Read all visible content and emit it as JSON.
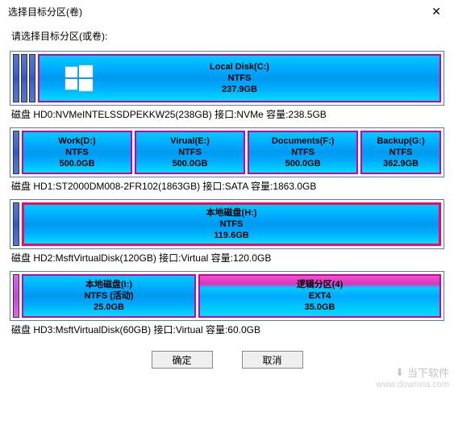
{
  "window": {
    "title": "选择目标分区(卷)"
  },
  "instruction": "请选择目标分区(或卷):",
  "disks": [
    {
      "label": "磁盘 HD0:NVMeINTELSSDPEKKW25(238GB) 接口:NVMe 容量:238.5GB",
      "partitions": [
        {
          "name": "Local Disk(C:)",
          "fs": "NTFS",
          "size": "237.9GB"
        }
      ]
    },
    {
      "label": "磁盘 HD1:ST2000DM008-2FR102(1863GB) 接口:SATA 容量:1863.0GB",
      "partitions": [
        {
          "name": "Work(D:)",
          "fs": "NTFS",
          "size": "500.0GB"
        },
        {
          "name": "Virual(E:)",
          "fs": "NTFS",
          "size": "500.0GB"
        },
        {
          "name": "Documents(F:)",
          "fs": "NTFS",
          "size": "500.0GB"
        },
        {
          "name": "Backup(G:)",
          "fs": "NTFS",
          "size": "362.9GB"
        }
      ]
    },
    {
      "label": "磁盘 HD2:MsftVirtualDisk(120GB) 接口:Virtual 容量:120.0GB",
      "partitions": [
        {
          "name": "本地磁盘(H:)",
          "fs": "NTFS",
          "size": "119.6GB"
        }
      ]
    },
    {
      "label": "磁盘 HD3:MsftVirtualDisk(60GB) 接口:Virtual 容量:60.0GB",
      "partitions": [
        {
          "name": "本地磁盘(I:)",
          "fs": "NTFS (活动)",
          "size": "25.0GB"
        },
        {
          "name": "逻辑分区(4)",
          "fs": "EXT4",
          "size": "35.0GB"
        }
      ]
    }
  ],
  "buttons": {
    "ok": "确定",
    "cancel": "取消"
  },
  "watermark": {
    "brand": "当下软件",
    "url": "www.downxia.com"
  }
}
